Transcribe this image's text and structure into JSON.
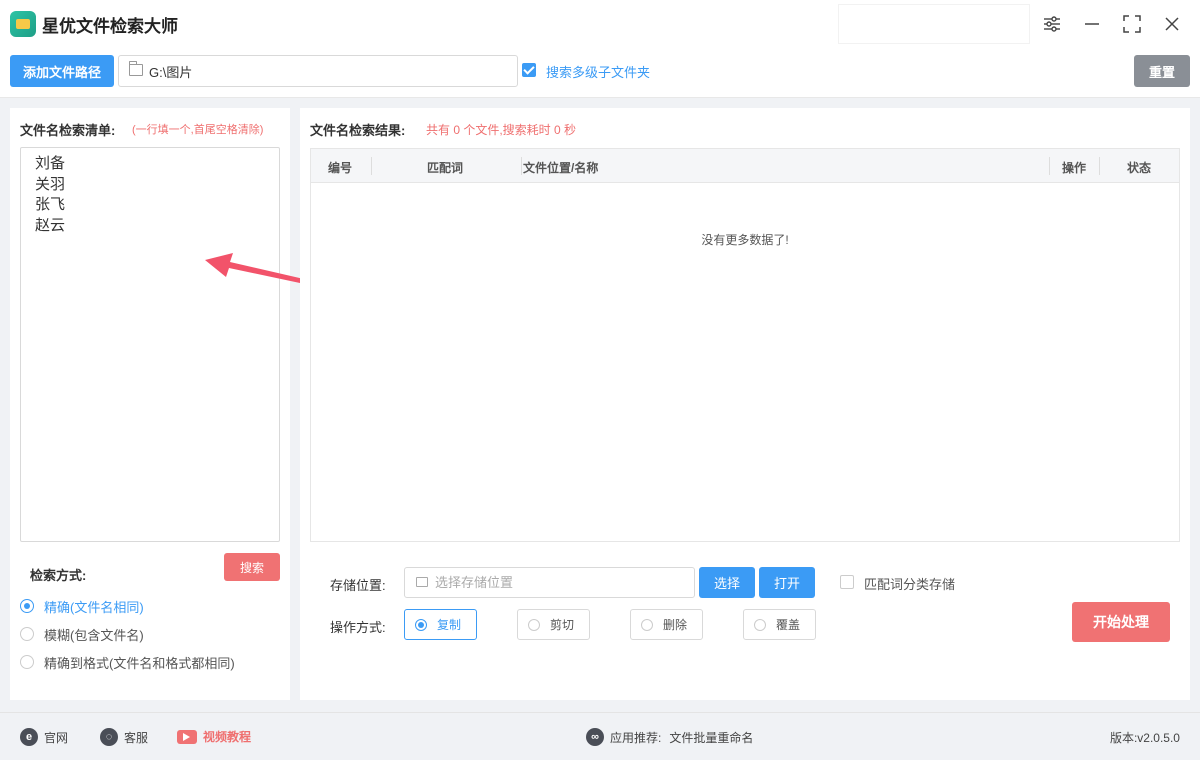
{
  "app": {
    "title": "星优文件检索大师"
  },
  "window_controls": {
    "settings_icon": "sliders-icon",
    "minimize_icon": "minimize-icon",
    "maximize_icon": "maximize-icon",
    "close_icon": "close-icon"
  },
  "toolbar": {
    "add_path_label": "添加文件路径",
    "path_value": "G:\\图片",
    "multi_level_label": "搜索多级子文件夹",
    "multi_level_checked": true,
    "reset_label": "重置"
  },
  "left_panel": {
    "title": "文件名检索清单:",
    "hint": "(一行填一个,首尾空格清除)",
    "names": [
      "刘备",
      "关羽",
      "张飞",
      "赵云"
    ],
    "search_mode_label": "检索方式:",
    "search_button_label": "搜索",
    "modes": [
      {
        "label": "精确(文件名相同)",
        "selected": true
      },
      {
        "label": "模糊(包含文件名)",
        "selected": false
      },
      {
        "label": "精确到格式(文件名和格式都相同)",
        "selected": false
      }
    ]
  },
  "right_panel": {
    "title": "文件名检索结果:",
    "stats": "共有 0 个文件,搜索耗时 0 秒",
    "columns": [
      "编号",
      "匹配词",
      "文件位置/名称",
      "操作",
      "状态"
    ],
    "empty_text": "没有更多数据了!",
    "storage_label": "存储位置:",
    "storage_placeholder": "选择存储位置",
    "choose_label": "选择",
    "open_label": "打开",
    "classify_label": "匹配词分类存储",
    "operation_label": "操作方式:",
    "operations": [
      {
        "label": "复制",
        "selected": true
      },
      {
        "label": "剪切",
        "selected": false
      },
      {
        "label": "删除",
        "selected": false
      },
      {
        "label": "覆盖",
        "selected": false
      }
    ],
    "start_label": "开始处理"
  },
  "footer": {
    "website_label": "官网",
    "support_label": "客服",
    "video_label": "视频教程",
    "recommend_label": "应用推荐:",
    "recommend_app": "文件批量重命名",
    "version": "版本:v2.0.5.0"
  }
}
